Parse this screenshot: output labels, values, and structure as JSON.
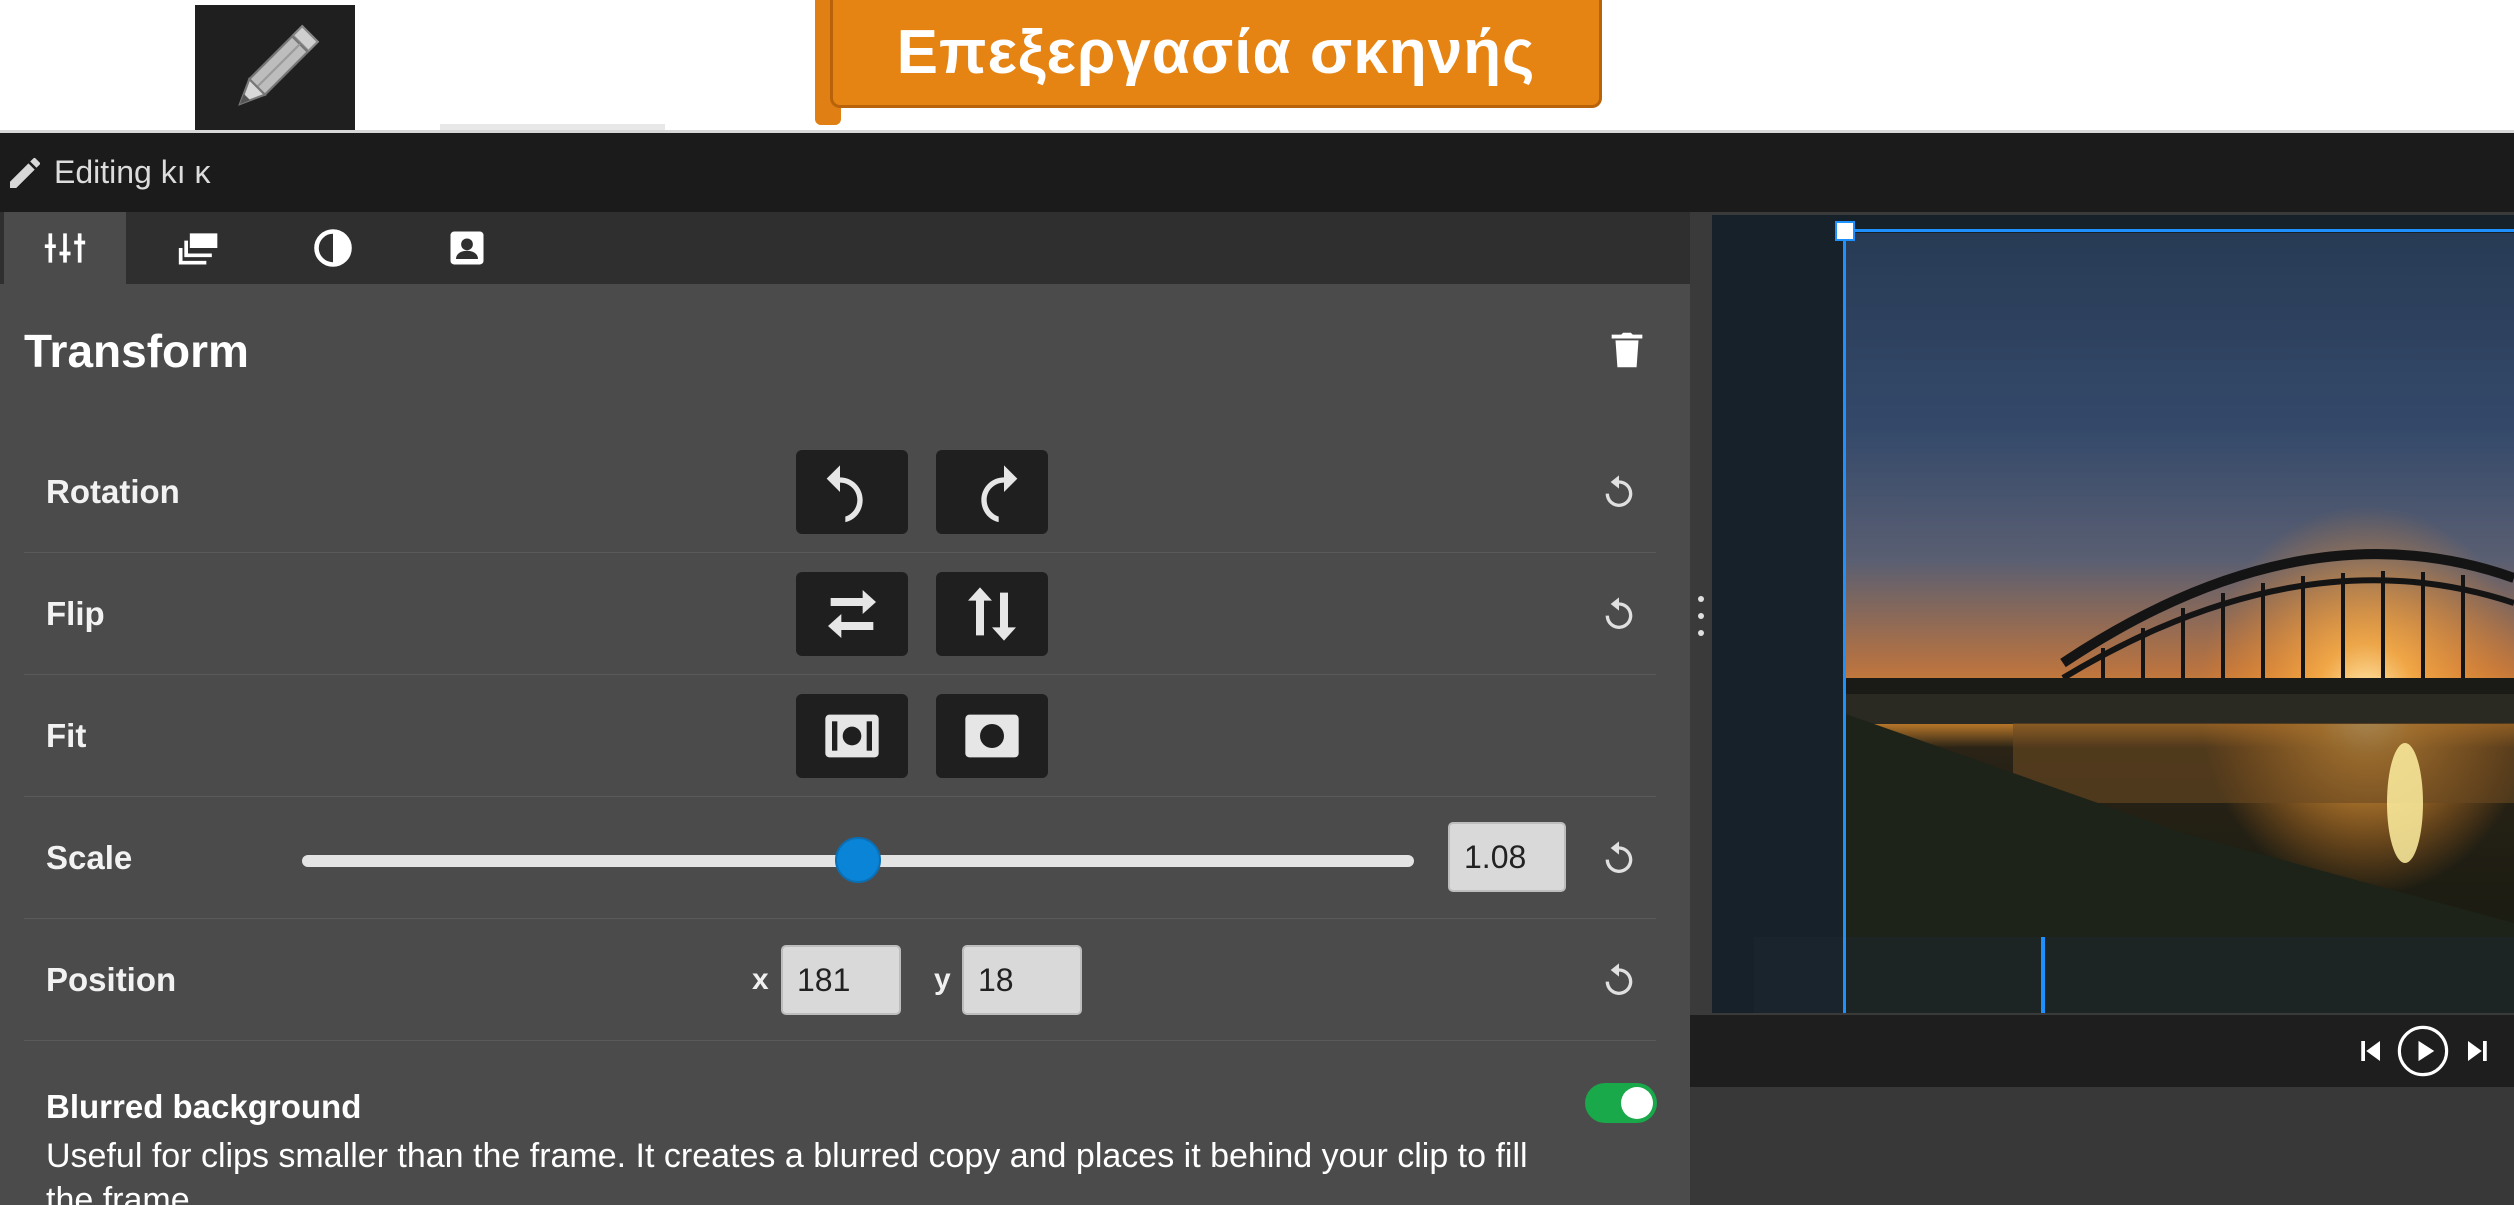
{
  "callout": {
    "text": "Επεξεργασία σκηνής"
  },
  "header": {
    "title": "Editing kı ĸ"
  },
  "tabs": [
    {
      "icon": "sliders-icon",
      "active": true
    },
    {
      "icon": "layers-icon",
      "active": false
    },
    {
      "icon": "contrast-icon",
      "active": false
    },
    {
      "icon": "portrait-icon",
      "active": false
    }
  ],
  "transform": {
    "title": "Transform",
    "rows": {
      "rotation": {
        "label": "Rotation"
      },
      "flip": {
        "label": "Flip"
      },
      "fit": {
        "label": "Fit"
      },
      "scale": {
        "label": "Scale",
        "value": "1.08",
        "slider_fraction": 0.5
      },
      "position": {
        "label": "Position",
        "x_label": "x",
        "x_value": "181",
        "y_label": "y",
        "y_value": "18"
      }
    }
  },
  "blurred_background": {
    "title": "Blurred background",
    "description": "Useful for clips smaller than the frame. It creates a blurred copy and places it behind your clip to fill the frame.",
    "enabled": true
  },
  "colors": {
    "accent": "#0a84d6",
    "toggle_on": "#19a84a",
    "callout": "#e58413",
    "selection": "#1e90ff"
  }
}
